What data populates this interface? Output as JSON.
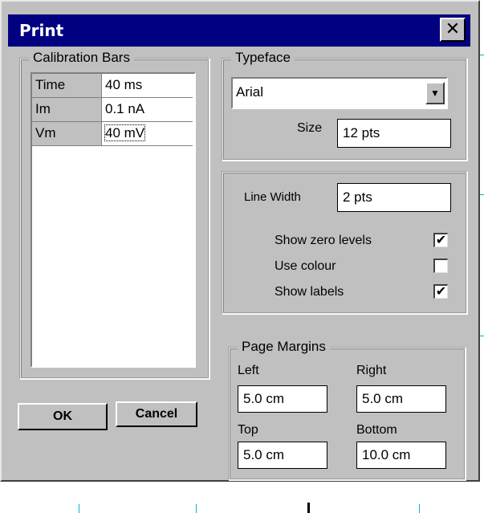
{
  "dialog": {
    "title": "Print",
    "close_glyph": "✕"
  },
  "calibration": {
    "label": "Calibration Bars",
    "rows": [
      {
        "name": "Time",
        "value": "40 ms"
      },
      {
        "name": "Im",
        "value": "0.1 nA"
      },
      {
        "name": "Vm",
        "value": "40 mV"
      }
    ]
  },
  "typeface": {
    "label": "Typeface",
    "font_value": "Arial",
    "dropdown_glyph": "▼",
    "size_label": "Size",
    "size_value": "12  pts"
  },
  "line": {
    "width_label": "Line Width",
    "width_value": "2  pts",
    "show_zero_levels_label": "Show zero levels",
    "show_zero_levels_checked": "✔",
    "use_colour_label": "Use colour",
    "use_colour_checked": "",
    "show_labels_label": "Show labels",
    "show_labels_checked": "✔"
  },
  "margins": {
    "label": "Page Margins",
    "left_label": "Left",
    "left_value": "5.0 cm",
    "right_label": "Right",
    "right_value": "5.0 cm",
    "top_label": "Top",
    "top_value": "5.0 cm",
    "bottom_label": "Bottom",
    "bottom_value": "10.0 cm"
  },
  "buttons": {
    "ok_label": "OK",
    "cancel_label": "Cancel"
  },
  "colors": {
    "titlebar": "#000080",
    "face": "#c0c0c0",
    "grid_tick": "#00b8c8"
  }
}
